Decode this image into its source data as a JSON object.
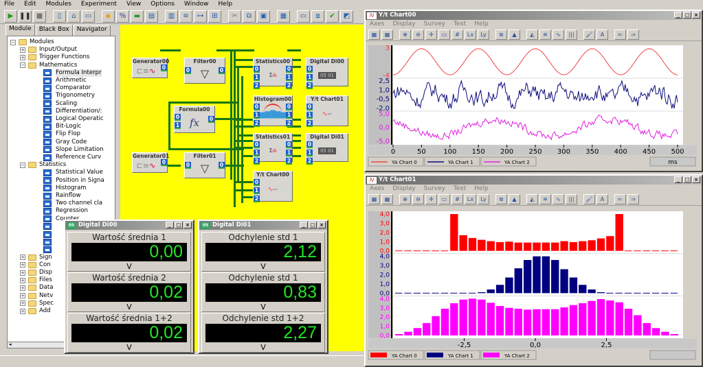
{
  "menu": [
    "File",
    "Edit",
    "Modules",
    "Experiment",
    "View",
    "Options",
    "Window",
    "Help"
  ],
  "toolbar": {
    "buttons": [
      "play-icon",
      "pause-icon",
      "stop-icon",
      "new-file-icon",
      "open-folder-icon",
      "save-icon",
      "module-icon",
      "formula-icon",
      "component-icon",
      "window-icon",
      "chart-add-icon",
      "tree-icon",
      "link-icon",
      "properties-icon",
      "cut-icon",
      "copy-icon",
      "paste-icon",
      "print-icon",
      "tile-icon",
      "cascade-icon",
      "check-icon",
      "arrange-icon"
    ]
  },
  "left_panel": {
    "tabs": [
      "Module",
      "Black Box",
      "Navigator"
    ],
    "active_tab": "Module",
    "tree": [
      {
        "label": "Modules",
        "level": 0,
        "type": "folder",
        "expander": "-"
      },
      {
        "label": "Input/Output",
        "level": 1,
        "type": "folder",
        "expander": "+"
      },
      {
        "label": "Trigger Functions",
        "level": 1,
        "type": "folder",
        "expander": "+"
      },
      {
        "label": "Mathematics",
        "level": 1,
        "type": "folder",
        "expander": "-"
      },
      {
        "label": "Formula Interpr",
        "level": 2,
        "type": "module",
        "selected": true
      },
      {
        "label": "Arithmetic",
        "level": 2,
        "type": "module"
      },
      {
        "label": "Comparator",
        "level": 2,
        "type": "module"
      },
      {
        "label": "Trigonometry",
        "level": 2,
        "type": "module"
      },
      {
        "label": "Scaling",
        "level": 2,
        "type": "module"
      },
      {
        "label": "Differentiation/:",
        "level": 2,
        "type": "module"
      },
      {
        "label": "Logical Operatic",
        "level": 2,
        "type": "module"
      },
      {
        "label": "Bit-Logic",
        "level": 2,
        "type": "module"
      },
      {
        "label": "Flip Flop",
        "level": 2,
        "type": "module"
      },
      {
        "label": "Gray Code",
        "level": 2,
        "type": "module"
      },
      {
        "label": "Slope Limitation",
        "level": 2,
        "type": "module"
      },
      {
        "label": "Reference Curv",
        "level": 2,
        "type": "module"
      },
      {
        "label": "Statistics",
        "level": 1,
        "type": "folder",
        "expander": "-"
      },
      {
        "label": "Statistical Value",
        "level": 2,
        "type": "module"
      },
      {
        "label": "Position in Signa",
        "level": 2,
        "type": "module"
      },
      {
        "label": "Histogram",
        "level": 2,
        "type": "module"
      },
      {
        "label": "Rainflow",
        "level": 2,
        "type": "module"
      },
      {
        "label": "Two channel cla",
        "level": 2,
        "type": "module"
      },
      {
        "label": "Regression",
        "level": 2,
        "type": "module"
      },
      {
        "label": "Counter",
        "level": 2,
        "type": "module"
      },
      {
        "label": "",
        "level": 2,
        "type": "module"
      },
      {
        "label": "",
        "level": 2,
        "type": "module"
      },
      {
        "label": "",
        "level": 2,
        "type": "module"
      },
      {
        "label": "",
        "level": 2,
        "type": "module"
      },
      {
        "label": "Sign",
        "level": 1,
        "type": "folder",
        "expander": "+"
      },
      {
        "label": "Con",
        "level": 1,
        "type": "folder",
        "expander": "+"
      },
      {
        "label": "Disp",
        "level": 1,
        "type": "folder",
        "expander": "+"
      },
      {
        "label": "Files",
        "level": 1,
        "type": "folder",
        "expander": "+"
      },
      {
        "label": "Data",
        "level": 1,
        "type": "folder",
        "expander": "+"
      },
      {
        "label": "Netv",
        "level": 1,
        "type": "folder",
        "expander": "+"
      },
      {
        "label": "Spec",
        "level": 1,
        "type": "folder",
        "expander": "+"
      },
      {
        "label": "Add",
        "level": 1,
        "type": "folder",
        "expander": "+"
      }
    ]
  },
  "workspace": {
    "blocks": {
      "generator00": "Generator00",
      "filter00": "Filter00",
      "formula00": "Formula00",
      "generator01": "Generator01",
      "filter01": "Filter01",
      "statistics00": "Statistics00",
      "histogram00": "Histogram00",
      "statistics01": "Statistics01",
      "digital00": "Digital Di00",
      "ytchart01": "Y/t Chart01",
      "digital01": "Digital Di01",
      "ytchart00": "Y/t Chart00"
    },
    "port_labels": [
      "0",
      "1",
      "2"
    ],
    "formula_symbol": "fx"
  },
  "digital00": {
    "title": "Digital Di00",
    "sections": [
      {
        "label": "Wartość średnia 1",
        "value": "0,00",
        "unit": "V"
      },
      {
        "label": "Wartość średnia 2",
        "value": "0,02",
        "unit": "V"
      },
      {
        "label": "Wartość średnia 1+2",
        "value": "0,02",
        "unit": "V"
      }
    ]
  },
  "digital01": {
    "title": "Digital Di01",
    "sections": [
      {
        "label": "Odchylenie std 1",
        "value": "2,12",
        "unit": "V"
      },
      {
        "label": "Odchylenie std 1",
        "value": "0,83",
        "unit": "V"
      },
      {
        "label": "Odchylenie std 1+2",
        "value": "2,27",
        "unit": "V"
      }
    ]
  },
  "chart_window_menu": [
    "Axes",
    "Display",
    "Survey",
    "Text",
    "Help"
  ],
  "chart_data": [
    {
      "type": "line",
      "title": "Y/t Chart00",
      "xlabel": "ms",
      "xlim": [
        0,
        500
      ],
      "x_ticks": [
        "0",
        "50",
        "100",
        "150",
        "200",
        "250",
        "300",
        "350",
        "400",
        "450",
        "500"
      ],
      "series": [
        {
          "name": "YA Chart 0",
          "color": "#ee4444",
          "y_ticks": [
            "3",
            "-4"
          ],
          "ylim": [
            -4,
            3
          ],
          "kind": "sine",
          "amplitude": 3.2,
          "period_ms": 100,
          "phase_ms": 0
        },
        {
          "name": "YA Chart 1",
          "color": "#0a0a7a",
          "y_ticks": [
            "2,5",
            "1,0",
            "-0,5",
            "-2,0"
          ],
          "ylim": [
            -2.5,
            2.5
          ],
          "kind": "noise",
          "amplitude": 1.6
        },
        {
          "name": "YA Chart 2",
          "color": "#e020e0",
          "y_ticks": [
            "5,0",
            "0,0",
            "-5,0"
          ],
          "ylim": [
            -6,
            6
          ],
          "kind": "sine+noise",
          "amplitude": 3.5,
          "period_ms": 200
        }
      ]
    },
    {
      "type": "bar",
      "title": "Y/t Chart01",
      "x_ticks": [
        "-2,5",
        "0,0",
        "2,5"
      ],
      "xlim": [
        -5,
        5
      ],
      "series": [
        {
          "name": "YA Chart 0",
          "color": "#ff0000",
          "y_ticks": [
            "4,0",
            "3,0",
            "2,0",
            "1,0",
            "0,0"
          ],
          "ylim": [
            0,
            4
          ],
          "values": [
            0,
            0,
            0,
            0,
            0,
            0,
            4.0,
            1.7,
            1.4,
            1.2,
            1.05,
            0.95,
            1.0,
            0.9,
            0.9,
            0.9,
            0.9,
            0.9,
            1.05,
            0.95,
            1.05,
            1.15,
            1.35,
            1.6,
            4.0,
            0,
            0,
            0,
            0,
            0,
            0
          ]
        },
        {
          "name": "YA Chart 1",
          "color": "#000080",
          "y_ticks": [
            "4,0",
            "3,0",
            "2,0",
            "1,0",
            "0,0"
          ],
          "ylim": [
            0,
            4
          ],
          "values": [
            0,
            0,
            0,
            0,
            0,
            0,
            0,
            0,
            0,
            0.1,
            0.4,
            0.9,
            1.7,
            2.7,
            3.6,
            4.0,
            4.0,
            3.6,
            2.6,
            1.7,
            0.9,
            0.4,
            0.1,
            0,
            0,
            0,
            0,
            0,
            0,
            0,
            0
          ]
        },
        {
          "name": "YA Chart 2",
          "color": "#ff00ff",
          "y_ticks": [
            "4,0",
            "3,0",
            "2,0",
            "1,0",
            "0,0"
          ],
          "ylim": [
            0,
            4
          ],
          "values": [
            0.15,
            0.4,
            0.8,
            1.35,
            2.1,
            2.9,
            3.5,
            3.9,
            4.0,
            3.9,
            3.55,
            3.2,
            3.0,
            2.9,
            2.8,
            2.85,
            2.85,
            2.85,
            3.05,
            3.3,
            3.5,
            3.75,
            3.95,
            3.8,
            3.6,
            2.9,
            2.2,
            1.35,
            0.8,
            0.4,
            0.15
          ]
        }
      ]
    }
  ],
  "chart00": {
    "title": "Y/t Chart00",
    "unit_box": "ms"
  },
  "chart01": {
    "title": "Y/t Chart01",
    "unit_box": ""
  }
}
